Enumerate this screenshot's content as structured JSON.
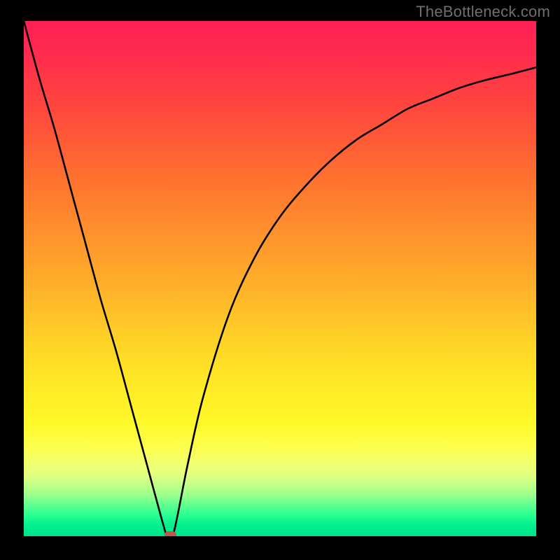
{
  "watermark": "TheBottleneck.com",
  "colors": {
    "background": "#000000",
    "curve": "#000000",
    "marker": "#c45549"
  },
  "chart_data": {
    "type": "line",
    "title": "",
    "xlabel": "",
    "ylabel": "",
    "xlim": [
      0,
      100
    ],
    "ylim": [
      0,
      100
    ],
    "grid": false,
    "legend": false,
    "annotations": [],
    "series": [
      {
        "name": "bottleneck-curve",
        "x": [
          0,
          3,
          6,
          9,
          12,
          15,
          18,
          21,
          24,
          27,
          28,
          29,
          30,
          32,
          35,
          40,
          45,
          50,
          55,
          60,
          65,
          70,
          75,
          80,
          85,
          90,
          95,
          100
        ],
        "values": [
          100,
          89,
          79,
          68,
          57,
          46,
          36,
          25,
          14,
          3,
          0,
          0,
          4,
          14,
          27,
          43,
          54,
          62,
          68,
          73,
          77,
          80,
          83,
          85,
          87,
          88.5,
          89.7,
          91
        ]
      }
    ],
    "minimum_point": {
      "x": 28.5,
      "y": 0
    },
    "background_gradient": {
      "orientation": "vertical",
      "stops": [
        {
          "pos": 0,
          "color": "#ff1f55"
        },
        {
          "pos": 0.3,
          "color": "#ff7030"
        },
        {
          "pos": 0.62,
          "color": "#ffd227"
        },
        {
          "pos": 0.8,
          "color": "#fff92a"
        },
        {
          "pos": 0.92,
          "color": "#8eff8d"
        },
        {
          "pos": 1.0,
          "color": "#00e28e"
        }
      ]
    }
  }
}
